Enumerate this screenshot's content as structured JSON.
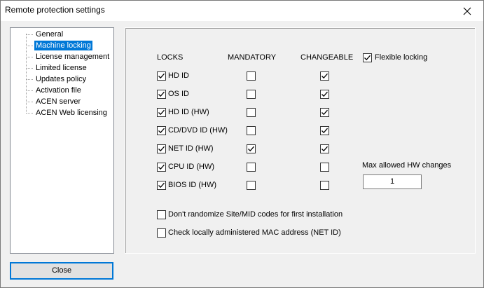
{
  "window": {
    "title": "Remote protection settings"
  },
  "tree": {
    "items": [
      {
        "label": "General",
        "selected": false
      },
      {
        "label": "Machine locking",
        "selected": true
      },
      {
        "label": "License management",
        "selected": false
      },
      {
        "label": "Limited license",
        "selected": false
      },
      {
        "label": "Updates policy",
        "selected": false
      },
      {
        "label": "Activation file",
        "selected": false
      },
      {
        "label": "ACEN server",
        "selected": false
      },
      {
        "label": "ACEN Web licensing",
        "selected": false
      }
    ]
  },
  "locks": {
    "header_locks": "LOCKS",
    "header_mandatory": "MANDATORY",
    "header_changeable": "CHANGEABLE",
    "rows": [
      {
        "label": "HD ID",
        "lock": true,
        "mandatory": false,
        "changeable": true
      },
      {
        "label": "OS ID",
        "lock": true,
        "mandatory": false,
        "changeable": true
      },
      {
        "label": "HD ID (HW)",
        "lock": true,
        "mandatory": false,
        "changeable": true
      },
      {
        "label": "CD/DVD ID (HW)",
        "lock": true,
        "mandatory": false,
        "changeable": true
      },
      {
        "label": "NET ID (HW)",
        "lock": true,
        "mandatory": true,
        "changeable": true
      },
      {
        "label": "CPU ID (HW)",
        "lock": true,
        "mandatory": false,
        "changeable": false
      },
      {
        "label": "BIOS ID (HW)",
        "lock": true,
        "mandatory": false,
        "changeable": false
      }
    ]
  },
  "flexible": {
    "label": "Flexible locking",
    "checked": true
  },
  "max_hw": {
    "label": "Max allowed HW changes",
    "value": "1"
  },
  "options": [
    {
      "label": "Don't randomize Site/MID codes for first installation",
      "checked": false
    },
    {
      "label": "Check locally administered MAC address (NET ID)",
      "checked": false
    }
  ],
  "buttons": {
    "close_label": "Close"
  }
}
